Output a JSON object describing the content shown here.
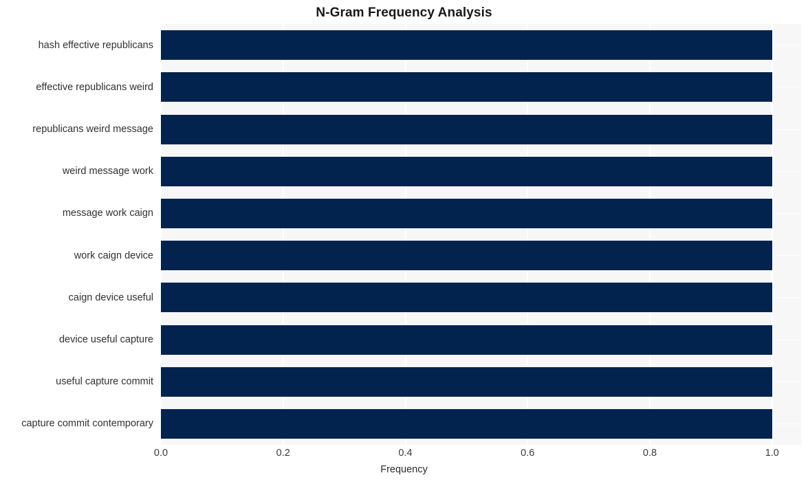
{
  "chart_data": {
    "type": "bar",
    "orientation": "horizontal",
    "title": "N-Gram Frequency Analysis",
    "xlabel": "Frequency",
    "ylabel": "",
    "categories": [
      "hash effective republicans",
      "effective republicans weird",
      "republicans weird message",
      "weird message work",
      "message work caign",
      "work caign device",
      "caign device useful",
      "device useful capture",
      "useful capture commit",
      "capture commit contemporary"
    ],
    "values": [
      1.0,
      1.0,
      1.0,
      1.0,
      1.0,
      1.0,
      1.0,
      1.0,
      1.0,
      1.0
    ],
    "xlim": [
      0.0,
      1.0475
    ],
    "xticks": [
      0.0,
      0.2,
      0.4,
      0.6,
      0.8,
      1.0
    ],
    "xtick_labels": [
      "0.0",
      "0.2",
      "0.4",
      "0.6",
      "0.8",
      "1.0"
    ],
    "grid": true,
    "legend": null,
    "bar_color": "#02234e",
    "plot_background": "#f7f7f7",
    "grid_color": "#ffffff",
    "figure_background": "#ffffff"
  }
}
